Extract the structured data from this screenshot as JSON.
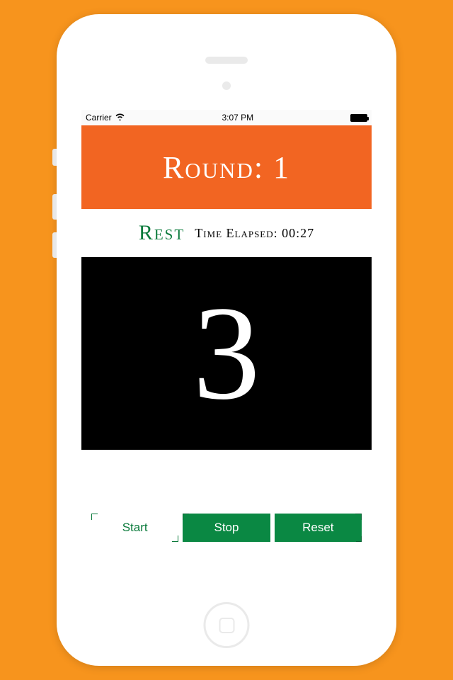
{
  "status_bar": {
    "carrier": "Carrier",
    "time": "3:07 PM"
  },
  "round_banner": {
    "label": "Round: 1"
  },
  "info": {
    "state_label": "Rest",
    "elapsed_label": "Time Elapsed: 00:27"
  },
  "countdown": {
    "value": "3"
  },
  "controls": {
    "start": "Start",
    "stop": "Stop",
    "reset": "Reset"
  },
  "colors": {
    "background": "#F7941D",
    "banner": "#F26522",
    "accent_green": "#0a8843",
    "text_green": "#0a7a3b"
  }
}
